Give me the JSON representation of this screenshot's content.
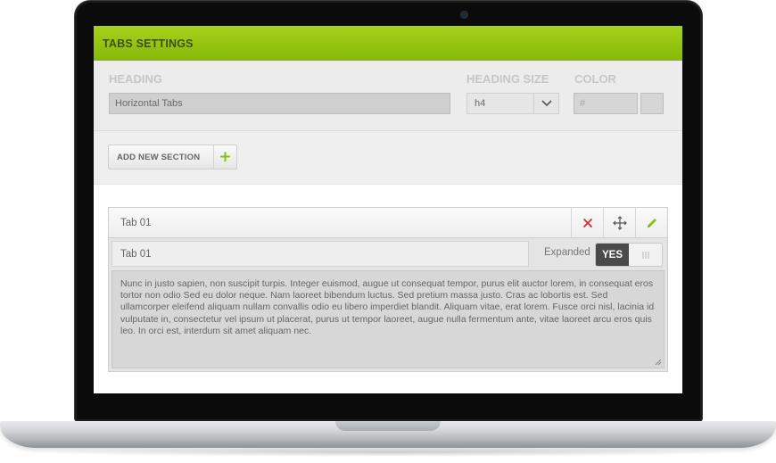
{
  "titlebar": {
    "title": "TABS SETTINGS"
  },
  "heading_row": {
    "heading_label": "HEADING",
    "heading_value": "Horizontal Tabs",
    "heading_size_label": "HEADING SIZE",
    "heading_size_value": "h4",
    "color_label": "COLOR",
    "color_placeholder": "#"
  },
  "add_section": {
    "label": "ADD NEW SECTION",
    "plus": "+"
  },
  "tab": {
    "name": "Tab 01",
    "title_value": "Tab 01",
    "expanded_label": "Expanded",
    "toggle_label": "YES",
    "description": "Nunc in justo sapien, non suscipit turpis. Integer euismod, augue ut consequat tempor, purus elit auctor lorem, in consequat eros tortor non odio Sed eu dolor neque. Nam laoreet bibendum luctus. Sed pretium massa justo. Cras ac lobortis est. Sed ullamcorper eleifend aliquam nullam convallis odio eu libero imperdiet blandit. Aliquam vitae, erat lorem. Fusce orci nisl, lacinia id vulputate in, consectetur vel ipsum ut placerat, purus ut tempor laoreet, augue nulla fermentum ante, vitae laoreet arcu eros quis leo. In orci est, interdum sit amet aliquam nec."
  },
  "icons": {
    "delete": "close-icon",
    "move": "move-icon",
    "edit": "pencil-icon",
    "dropdown": "chevron-down-icon"
  },
  "colors": {
    "accent_green": "#8bbd12",
    "delete_red": "#d32f2f",
    "toggle_on": "#4a4a4a"
  }
}
